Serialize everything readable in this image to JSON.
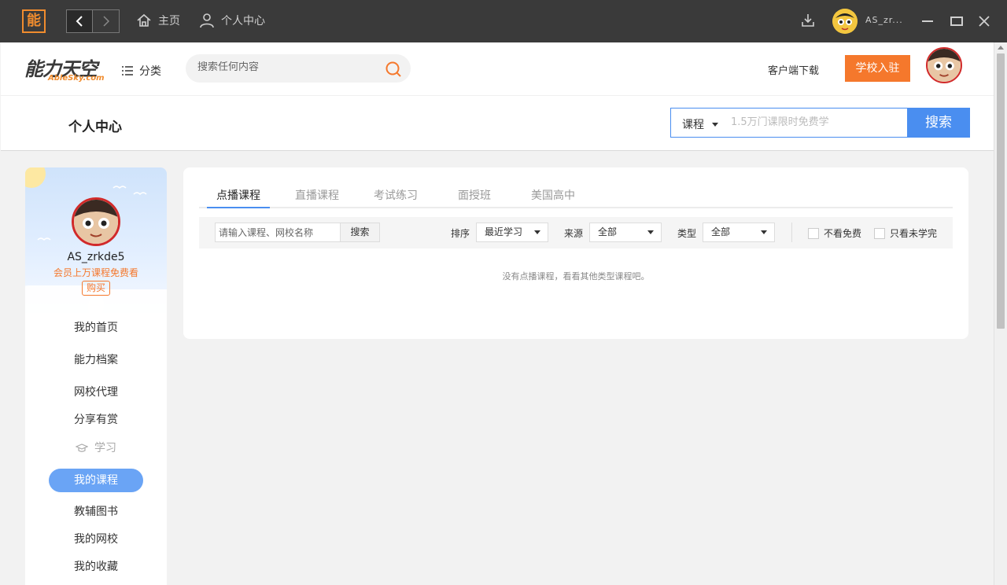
{
  "titlebar": {
    "logo_char": "能",
    "home_label": "主页",
    "center_label": "个人中心",
    "username": "AS_zr..."
  },
  "header": {
    "brand_cn": "能力天空",
    "brand_en": "AbleSky.com",
    "category_label": "分类",
    "search_placeholder": "搜索任何内容",
    "client_download": "客户端下载",
    "school_button": "学校入驻"
  },
  "page": {
    "title": "个人中心",
    "course_search": {
      "select_value": "课程",
      "placeholder": "1.5万门课限时免费学",
      "button": "搜索"
    }
  },
  "sidebar": {
    "username": "AS_zrkde5",
    "promo": "会员上万课程免费看",
    "buy_label": "购买",
    "items": [
      {
        "label": "我的首页"
      },
      {
        "label": "能力档案"
      },
      {
        "label": "网校代理"
      },
      {
        "label": "分享有赏"
      }
    ],
    "section_label": "学习",
    "study_items": [
      {
        "label": "我的课程",
        "active": true
      },
      {
        "label": "教辅图书"
      },
      {
        "label": "我的网校"
      },
      {
        "label": "我的收藏"
      }
    ]
  },
  "main": {
    "tabs": [
      {
        "label": "点播课程",
        "active": true
      },
      {
        "label": "直播课程"
      },
      {
        "label": "考试练习"
      },
      {
        "label": "面授班"
      },
      {
        "label": "美国高中"
      }
    ],
    "filter": {
      "input_placeholder": "请输入课程、网校名称",
      "search_button": "搜索",
      "sort_label": "排序",
      "sort_value": "最近学习",
      "source_label": "来源",
      "source_value": "全部",
      "type_label": "类型",
      "type_value": "全部",
      "check_no_free": "不看免费",
      "check_unfinished": "只看未学完"
    },
    "empty_message": "没有点播课程，看看其他类型课程吧。"
  },
  "colors": {
    "accent_blue": "#4a8ef0",
    "accent_orange": "#f5782c",
    "titlebar_bg": "#3a3a3a"
  }
}
